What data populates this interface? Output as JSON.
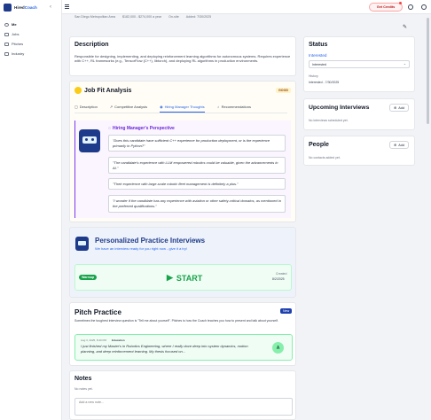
{
  "app": {
    "brand_a": "Hired",
    "brand_b": "Coach",
    "credits": "Get Credits"
  },
  "nav": {
    "items": [
      {
        "label": "Me"
      },
      {
        "label": "Jobs"
      },
      {
        "label": "Pitches"
      },
      {
        "label": "Industry"
      }
    ]
  },
  "meta": {
    "location": "San Diego Metropolitan Area",
    "salary": "$182,000 - $274,000 a year",
    "workplace": "On-site",
    "added": "Added: 7/30/2025"
  },
  "description": {
    "title": "Description",
    "text": "Responsible for designing, implementing, and deploying reinforcement learning algorithms for autonomous systems. Requires experience with C++, RL frameworks (e.g., TensorFlow (C++), libtorch), and deploying RL algorithms in production environments."
  },
  "job_fit": {
    "title": "Job Fit Analysis",
    "badge": "GOOD",
    "tabs": [
      "Description",
      "Competitive Analysis",
      "Hiring Manager Thoughts",
      "Recommendations"
    ],
    "perspective_title": "Hiring Manager's Perspective",
    "quotes": [
      "\"Does this candidate have sufficient C++ experience for production deployment, or is the experience primarily in Python?\"",
      "\"The candidate's experience with LLM empowered robotics could be valuable, given the advancements in AI.\"",
      "\"Their experience with large-scale robotic fleet management is definitely a plus.\"",
      "\"I wonder if the candidate has any experience with aviation or other safety-critical domains, as mentioned in the preferred qualifications.\""
    ]
  },
  "practice": {
    "title": "Personalized Practice Interviews",
    "subtitle": "We have an interview ready for you right now - give it a try!",
    "chip": "Warmup",
    "start": "START",
    "created_label": "Created",
    "created_date": "8/2/2025"
  },
  "pitch": {
    "title": "Pitch Practice",
    "new_label": "New",
    "intro": "Sometimes the toughest interview question is \"Tell me about yourself\". Pitches is how the Coach teaches you how to present and talk about yourself.",
    "entry_date": "Aug 3, 2025, 8:40 PM",
    "entry_tag": "Education",
    "entry_text": "I just finished my Master's in Robotics Engineering, where I really dove deep into system dynamics, motion planning, and deep reinforcement learning. My thesis focused on...",
    "grade": "A"
  },
  "notes": {
    "title": "Notes",
    "empty": "No notes yet.",
    "placeholder": "Add a new note..."
  },
  "status": {
    "title": "Status",
    "current": "Interested",
    "select_value": "Interested",
    "history_label": "History",
    "history_entry": "Interested - 7/30/2025"
  },
  "upcoming": {
    "title": "Upcoming Interviews",
    "add": "Add",
    "empty": "No interviews scheduled yet."
  },
  "people": {
    "title": "People",
    "add": "Add",
    "empty": "No contacts added yet."
  },
  "colors": {
    "accent": "#2563eb",
    "practice_title": "#1e3a8a",
    "good_badge": "#facc15",
    "start_green": "#16a34a"
  }
}
